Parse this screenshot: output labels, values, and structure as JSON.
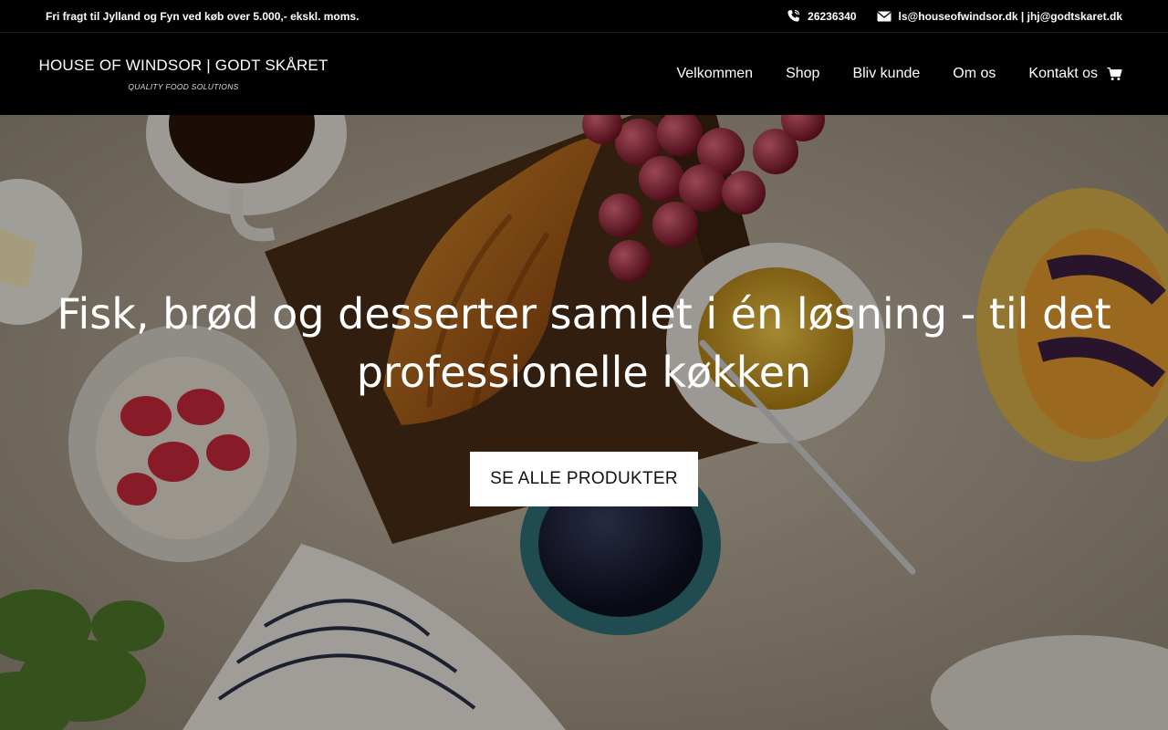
{
  "topbar": {
    "shipping_note": "Fri fragt til Jylland og Fyn ved køb over 5.000,- ekskl. moms.",
    "phone": "26236340",
    "email": "ls@houseofwindsor.dk | jhj@godtskaret.dk"
  },
  "header": {
    "logo_main": "HOUSE OF WINDSOR | GODT SKÅRET",
    "logo_sub": "QUALITY FOOD SOLUTIONS",
    "nav": [
      {
        "label": "Velkommen"
      },
      {
        "label": "Shop"
      },
      {
        "label": "Bliv kunde"
      },
      {
        "label": "Om os"
      },
      {
        "label": "Kontakt os"
      }
    ]
  },
  "hero": {
    "title": "Fisk, brød og desserter samlet i én løsning - til det professionelle køkken",
    "button_label": "SE ALLE PRODUKTER"
  },
  "icons": {
    "phone": "phone-icon",
    "email": "envelope-icon",
    "cart": "shopping-cart-icon"
  }
}
